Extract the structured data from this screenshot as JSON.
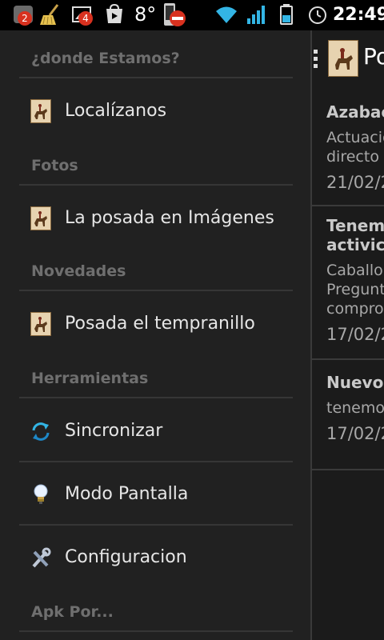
{
  "status_bar": {
    "badge_left": "2",
    "badge_mid": "4",
    "temperature": "8°",
    "time": "22:49",
    "colors": {
      "badge": "#d8311f",
      "wifi": "#33b5e5",
      "signal": "#33b5e5"
    }
  },
  "drawer": {
    "sections": [
      {
        "header": "¿donde Estamos?",
        "items": [
          {
            "label": "Localízanos",
            "icon": "horse-logo-icon"
          }
        ]
      },
      {
        "header": "Fotos",
        "items": [
          {
            "label": "La posada en Imágenes",
            "icon": "horse-logo-icon"
          }
        ]
      },
      {
        "header": "Novedades",
        "items": [
          {
            "label": "Posada el tempranillo",
            "icon": "horse-logo-icon"
          }
        ]
      },
      {
        "header": "Herramientas",
        "items": [
          {
            "label": "Sincronizar",
            "icon": "sync-icon"
          },
          {
            "label": "Modo Pantalla",
            "icon": "lightbulb-icon"
          },
          {
            "label": "Configuracion",
            "icon": "wrench-icon"
          }
        ]
      },
      {
        "header": "Apk Por...",
        "items": []
      }
    ]
  },
  "content": {
    "title": "Po",
    "feed": [
      {
        "title_lines": [
          "Azabac"
        ],
        "body_lines": [
          "Actuacio",
          "directo"
        ],
        "date": "21/02/2"
      },
      {
        "title_lines": [
          "Tenem",
          "activic"
        ],
        "body_lines": [
          "Caballo,",
          "Pregunt",
          "compro"
        ],
        "date": "17/02/2"
      },
      {
        "title_lines": [
          "Nuevo"
        ],
        "body_lines": [
          "tenemo"
        ],
        "date": "17/02/2"
      }
    ]
  }
}
